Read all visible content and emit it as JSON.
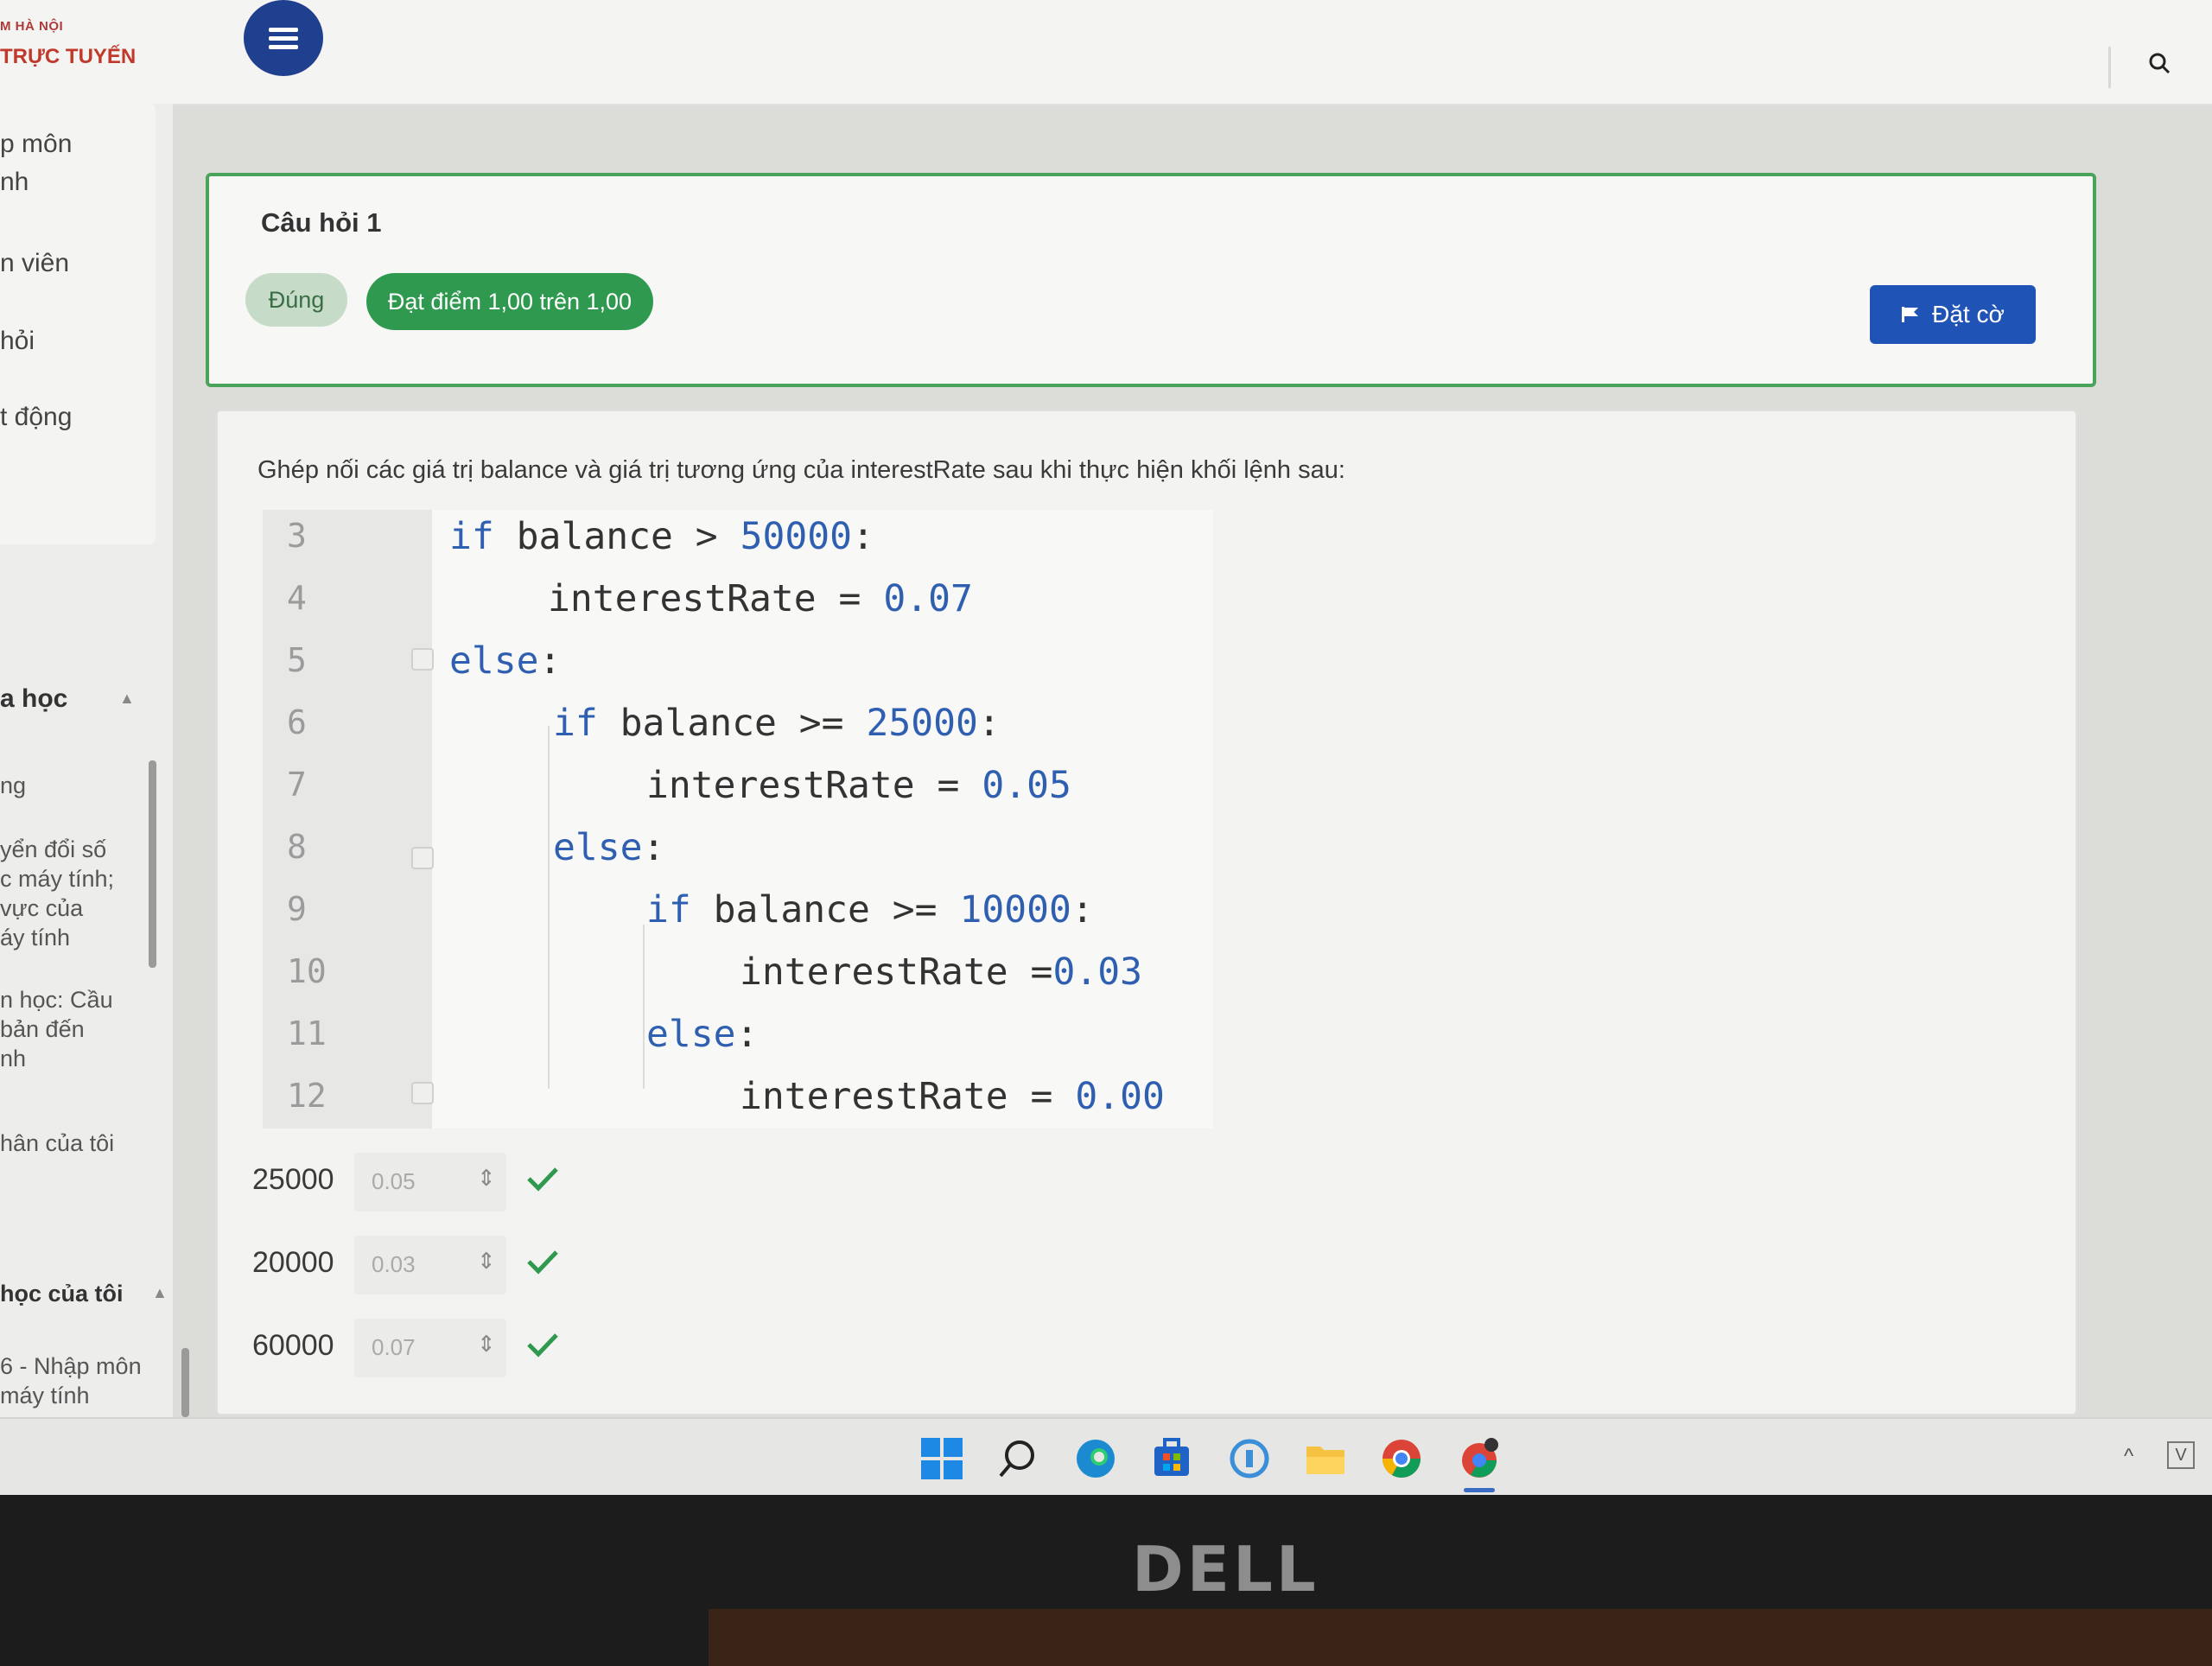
{
  "header": {
    "logo_top": "M HÀ NỘI",
    "logo_main": "TRỰC TUYẾN"
  },
  "sidebar": {
    "items": [
      {
        "line1": "p môn",
        "line2": "nh"
      },
      {
        "label": "n viên"
      },
      {
        "label": "hỏi"
      },
      {
        "label": "t động"
      }
    ],
    "section_course": "a học",
    "course_items": [
      {
        "label": "ng"
      },
      {
        "lines": [
          "yển đổi số",
          "c máy tính;",
          "vực của",
          "áy tính"
        ]
      },
      {
        "lines": [
          "n học: Cầu",
          "bản đến",
          "nh"
        ]
      }
    ],
    "personal": "hân của tôi",
    "section_my_courses": "học của tôi",
    "my_course_item": {
      "line1": "6 - Nhập môn",
      "line2": " máy tính"
    }
  },
  "question": {
    "title": "Câu hỏi 1",
    "status": "Đúng",
    "score": "Đạt điểm 1,00 trên 1,00",
    "flag_label": "Đặt cờ"
  },
  "prompt": "Ghép nối các giá trị balance và giá trị tương ứng của interestRate sau khi thực hiện khối lệnh sau:",
  "code_lines": [
    {
      "n": "3",
      "parts": [
        "if",
        " balance > ",
        "50000",
        ":"
      ]
    },
    {
      "n": "4",
      "parts": [
        "interestRate = ",
        "0.07"
      ]
    },
    {
      "n": "5",
      "parts": [
        "else",
        ":"
      ]
    },
    {
      "n": "6",
      "parts": [
        "if",
        " balance >= ",
        "25000",
        ":"
      ]
    },
    {
      "n": "7",
      "parts": [
        "interestRate = ",
        "0.05"
      ]
    },
    {
      "n": "8",
      "parts": [
        "else",
        ":"
      ]
    },
    {
      "n": "9",
      "parts": [
        "if",
        " balance >= ",
        "10000",
        ":"
      ]
    },
    {
      "n": "10",
      "parts": [
        "interestRate =",
        "0.03"
      ]
    },
    {
      "n": "11",
      "parts": [
        "else",
        ":"
      ]
    },
    {
      "n": "12",
      "parts": [
        "interestRate = ",
        "0.00"
      ]
    }
  ],
  "matches": [
    {
      "value": "25000",
      "selected": "0.05"
    },
    {
      "value": "20000",
      "selected": "0.03"
    },
    {
      "value": "60000",
      "selected": "0.07"
    }
  ],
  "select_arrow": "⇕",
  "taskbar": {
    "icons": [
      "windows-start-icon",
      "search-icon",
      "edge-icon",
      "store-icon",
      "app-circle-icon",
      "file-explorer-icon",
      "chrome-icon",
      "chrome-dev-icon"
    ],
    "tray_up": "^",
    "tray_v": "V"
  },
  "monitor_brand": "DELL",
  "colors": {
    "accent_blue": "#1f53b5",
    "correct_green": "#2f9a4f",
    "keyword_blue": "#2f5fb0"
  }
}
